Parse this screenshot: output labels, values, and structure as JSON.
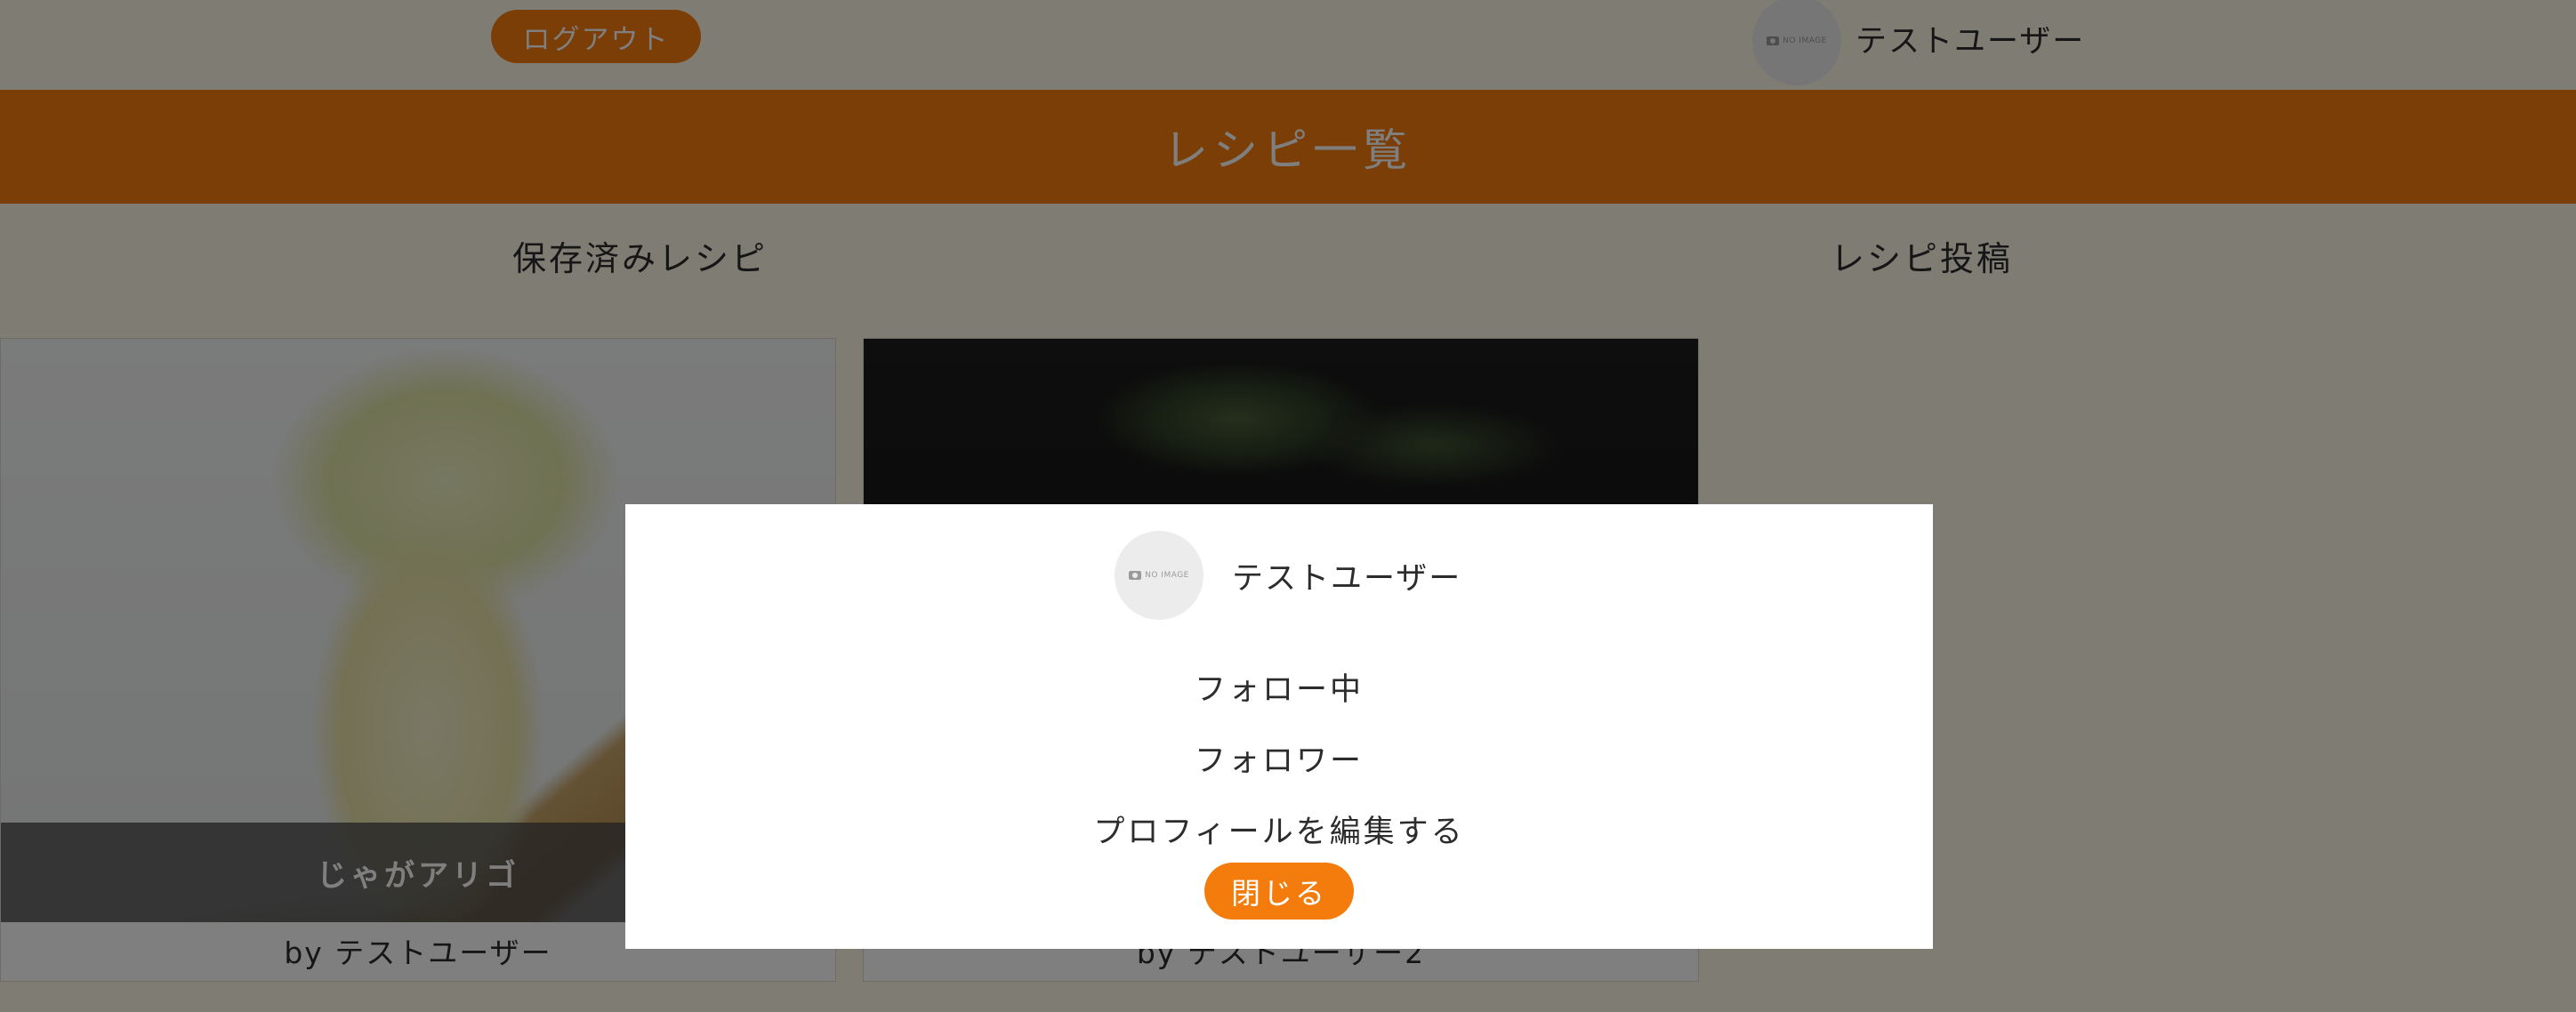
{
  "header": {
    "logout_label": "ログアウト",
    "user_name": "テストユーザー",
    "avatar_placeholder": "NO IMAGE"
  },
  "banner": {
    "title": "レシピ一覧"
  },
  "nav": {
    "saved_label": "保存済みレシピ",
    "post_label": "レシピ投稿"
  },
  "recipes": [
    {
      "title": "じゃがアリゴ",
      "byline": "by テストユーザー"
    },
    {
      "title": "",
      "byline": "by テストユーザー2"
    }
  ],
  "modal": {
    "user_name": "テストユーザー",
    "avatar_placeholder": "NO IMAGE",
    "following_label": "フォロー中",
    "followers_label": "フォロワー",
    "edit_profile_label": "プロフィールを編集する",
    "close_label": "閉じる"
  },
  "colors": {
    "accent": "#f47c0c",
    "background": "#fff8e9",
    "overlay": "rgba(0,0,0,0.5)"
  }
}
